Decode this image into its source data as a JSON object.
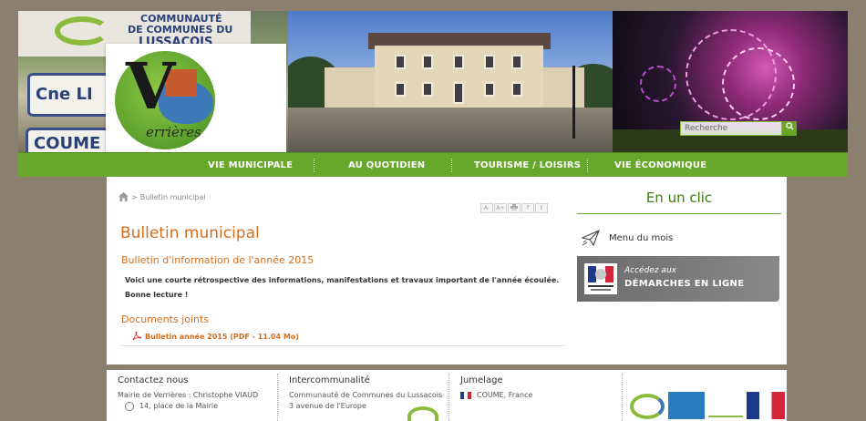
{
  "header": {
    "search": {
      "placeholder": "Recherche"
    },
    "logo_text": "errières",
    "sign_top_line1": "COMMUNAUTÉ",
    "sign_top_line2": "DE COMMUNES DU",
    "sign_top_line3": "LUSSACOIS",
    "sign_bottom_line1": "Cne LI",
    "sign_bottom_line2": "COUME"
  },
  "nav": {
    "items": [
      {
        "label": "VIE MUNICIPALE"
      },
      {
        "label": "AU QUOTIDIEN"
      },
      {
        "label": "TOURISME / LOISIRS"
      },
      {
        "label": "VIE ÉCONOMIQUE"
      }
    ]
  },
  "breadcrumb": {
    "separator": ">",
    "current": "Bulletin municipal"
  },
  "tools": [
    "A-",
    "A+",
    "print",
    "f",
    "t"
  ],
  "main": {
    "title": "Bulletin municipal",
    "subtitle": "Bulletin d'information de l'année 2015",
    "intro_line1": "Voici une courte rétrospective des informations, manifestations et travaux important de l'année écoulée.",
    "intro_line2": "Bonne lecture !",
    "docs_heading": "Documents joints",
    "doc_link": "Bulletin année 2015 (PDF - 11.04 Mo)"
  },
  "sidebar": {
    "title": "En un clic",
    "menu_item": "Menu du mois",
    "demarches_line1": "Accédez aux",
    "demarches_line2": "DÉMARCHES EN LIGNE"
  },
  "footer": {
    "contact": {
      "heading": "Contactez nous",
      "line1": "Mairie de Verrières : Christophe VIAUD",
      "line2": "14, place de la Mairie"
    },
    "interco": {
      "heading": "Intercommunalité",
      "line1": "Communauté de Communes du Lussacois",
      "line2": "3 avenue de l'Europe"
    },
    "jumelage": {
      "heading": "Jumelage",
      "line1": "COUME, France"
    }
  },
  "colors": {
    "nav_green": "#67a82c",
    "title_orange": "#d36e1e",
    "sidebar_green": "#3f7a12",
    "body_bg": "#8b8070"
  }
}
